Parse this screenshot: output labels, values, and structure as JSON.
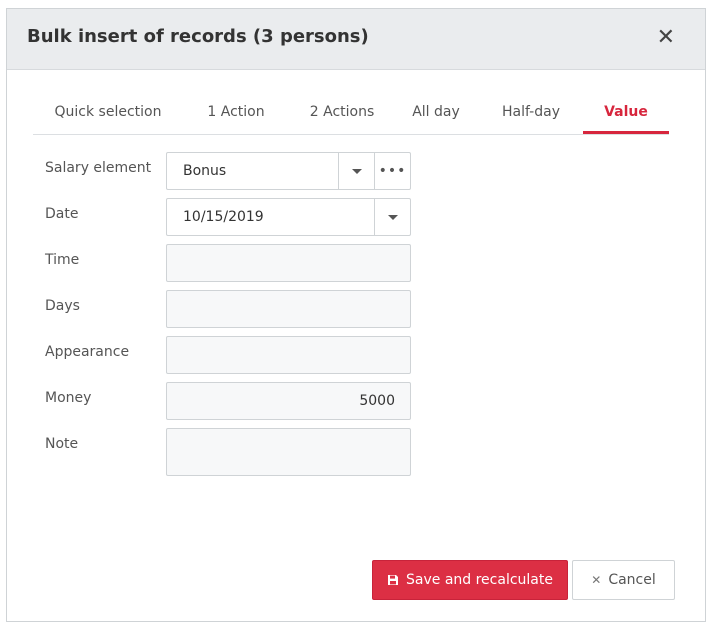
{
  "dialog": {
    "title": "Bulk insert of records (3 persons)",
    "close_glyph": "✕"
  },
  "tabs": [
    {
      "label": "Quick selection",
      "active": false
    },
    {
      "label": "1 Action",
      "active": false
    },
    {
      "label": "2 Actions",
      "active": false
    },
    {
      "label": "All day",
      "active": false
    },
    {
      "label": "Half-day",
      "active": false
    },
    {
      "label": "Value",
      "active": true
    }
  ],
  "form": {
    "salary_element": {
      "label": "Salary element",
      "value": "Bonus",
      "more_glyph": "•••"
    },
    "date": {
      "label": "Date",
      "value": "10/15/2019"
    },
    "time": {
      "label": "Time",
      "value": ""
    },
    "days": {
      "label": "Days",
      "value": ""
    },
    "appearance": {
      "label": "Appearance",
      "value": ""
    },
    "money": {
      "label": "Money",
      "value": "5000"
    },
    "note": {
      "label": "Note",
      "value": ""
    }
  },
  "buttons": {
    "save_label": "Save and recalculate",
    "cancel_label": "Cancel",
    "cancel_glyph": "✕"
  },
  "colors": {
    "accent": "#dc2f44",
    "header_bg": "#eaecee"
  }
}
